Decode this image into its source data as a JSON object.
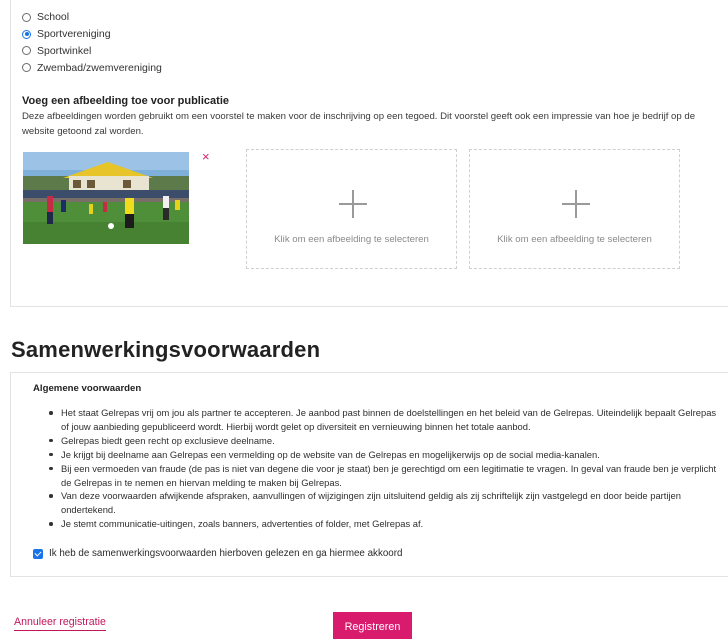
{
  "organisation_type": {
    "options": [
      {
        "label": "School",
        "selected": false
      },
      {
        "label": "Sportvereniging",
        "selected": true
      },
      {
        "label": "Sportwinkel",
        "selected": false
      },
      {
        "label": "Zwembad/zwemvereniging",
        "selected": false
      }
    ]
  },
  "image_upload": {
    "heading": "Voeg een afbeelding toe voor publicatie",
    "description": "Deze afbeeldingen worden gebruikt om een voorstel te maken voor de inschrijving op een tegoed. Dit voorstel geeft ook een impressie van hoe je bedrijf op de website getoond zal worden.",
    "remove_glyph": "×",
    "slot_label": "Klik om een afbeelding te selecteren"
  },
  "terms": {
    "section_title": "Samenwerkingsvoorwaarden",
    "heading": "Algemene voorwaarden",
    "items": [
      "Het staat Gelrepas vrij om jou als partner te accepteren. Je aanbod past binnen de doelstellingen en het beleid van de Gelrepas. Uiteindelijk bepaalt Gelrepas of jouw aanbieding gepubliceerd wordt. Hierbij wordt gelet op diversiteit en vernieuwing binnen het totale aanbod.",
      "Gelrepas biedt geen recht op exclusieve deelname.",
      "Je krijgt bij deelname aan Gelrepas een vermelding op de website van de Gelrepas en mogelijkerwijs op de social media-kanalen.",
      "Bij een vermoeden van fraude (de pas is niet van degene die voor je staat) ben je gerechtigd om een legitimatie te vragen. In geval van fraude ben je verplicht de Gelrepas in te nemen en hiervan melding te maken bij Gelrepas.",
      "Van deze voorwaarden afwijkende afspraken, aanvullingen of wijzigingen zijn uitsluitend geldig als zij schriftelijk zijn vastgelegd en door beide partijen ondertekend.",
      "Je stemt communicatie-uitingen, zoals banners, advertenties of folder, met Gelrepas af."
    ],
    "agree_label": "Ik heb de samenwerkingsvoorwaarden hierboven gelezen en ga hiermee akkoord",
    "agree_checked": true
  },
  "actions": {
    "cancel_label": "Annuleer registratie",
    "register_label": "Registreren"
  },
  "colors": {
    "accent": "#d91b6e",
    "link": "#c2185b",
    "checkbox": "#1a73e8"
  }
}
